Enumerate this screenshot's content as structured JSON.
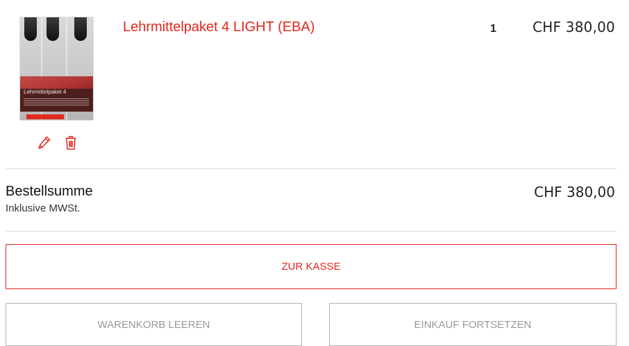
{
  "cart": {
    "items": [
      {
        "name": "Lehrmittelpaket 4 LIGHT (EBA)",
        "cover_title": "Lehrmittelpaket 4",
        "quantity": "1",
        "price": "CHF 380,00",
        "edit_icon": "pencil-icon",
        "delete_icon": "trash-icon"
      }
    ]
  },
  "summary": {
    "label": "Bestellsumme",
    "sublabel": "Inklusive MWSt.",
    "total": "CHF 380,00"
  },
  "actions": {
    "checkout_label": "ZUR KASSE",
    "clear_label": "WARENKORB LEEREN",
    "continue_label": "EINKAUF FORTSETZEN"
  },
  "colors": {
    "accent": "#e3271c",
    "muted": "#999999",
    "border": "#b5b5b5"
  }
}
